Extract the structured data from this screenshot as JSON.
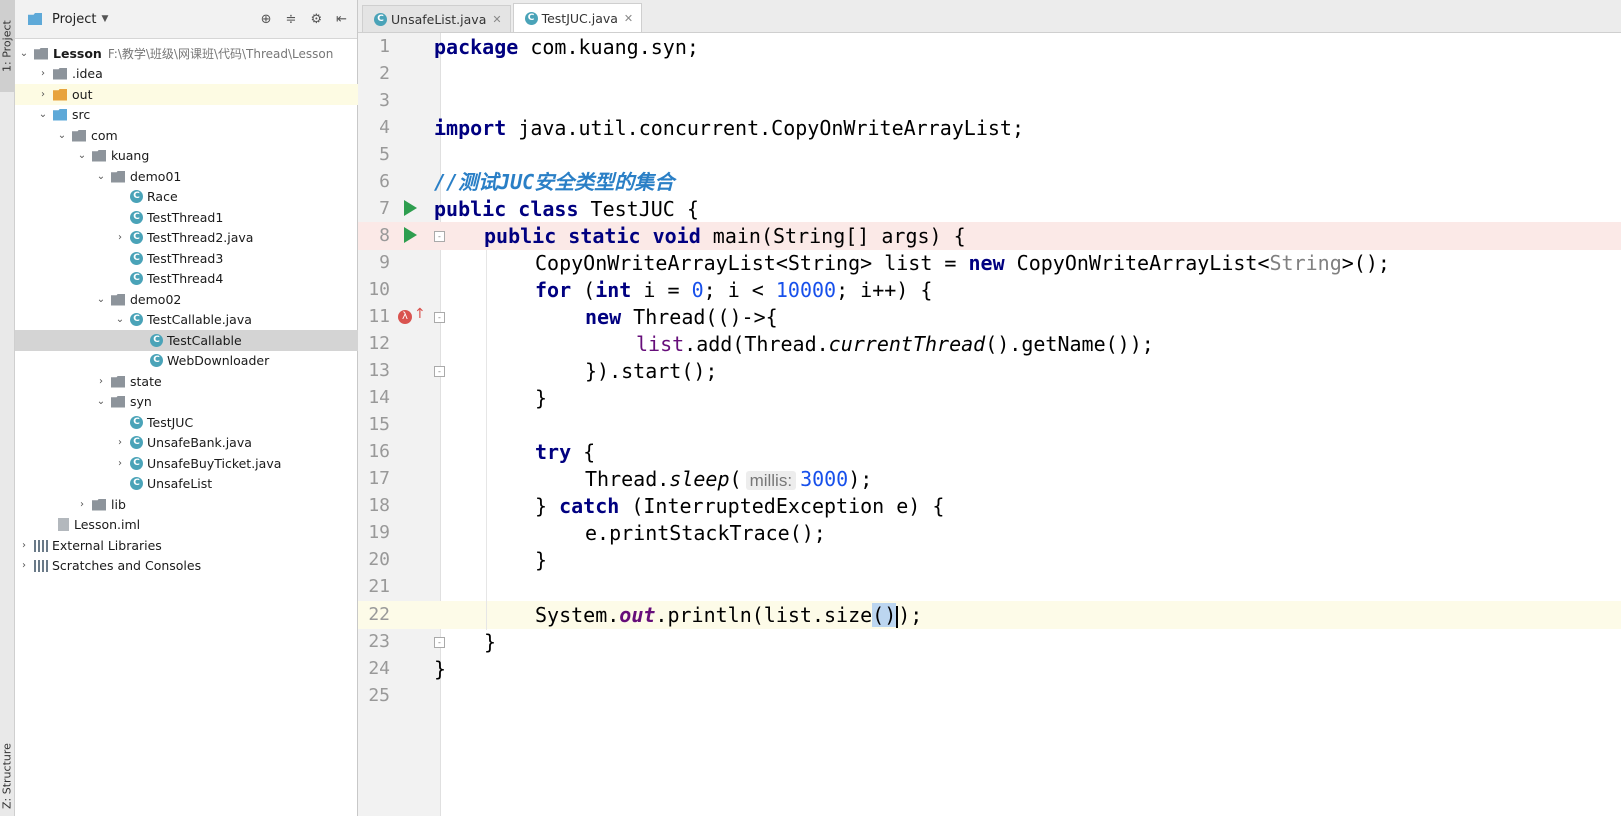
{
  "sidebar_tabs": {
    "project": "1: Project",
    "structure": "Z: Structure"
  },
  "project_panel": {
    "title": "Project",
    "tree": [
      {
        "label": "Lesson",
        "path": "F:\\教学\\班级\\网课班\\代码\\Thread\\Lesson"
      },
      {
        "label": ".idea"
      },
      {
        "label": "out"
      },
      {
        "label": "src"
      },
      {
        "label": "com"
      },
      {
        "label": "kuang"
      },
      {
        "label": "demo01"
      },
      {
        "label": "Race"
      },
      {
        "label": "TestThread1"
      },
      {
        "label": "TestThread2.java"
      },
      {
        "label": "TestThread3"
      },
      {
        "label": "TestThread4"
      },
      {
        "label": "demo02"
      },
      {
        "label": "TestCallable.java"
      },
      {
        "label": "TestCallable"
      },
      {
        "label": "WebDownloader"
      },
      {
        "label": "state"
      },
      {
        "label": "syn"
      },
      {
        "label": "TestJUC"
      },
      {
        "label": "UnsafeBank.java"
      },
      {
        "label": "UnsafeBuyTicket.java"
      },
      {
        "label": "UnsafeList"
      },
      {
        "label": "lib"
      },
      {
        "label": "Lesson.iml"
      },
      {
        "label": "External Libraries"
      },
      {
        "label": "Scratches and Consoles"
      }
    ]
  },
  "editor": {
    "tabs": [
      {
        "label": "UnsafeList.java"
      },
      {
        "label": "TestJUC.java"
      }
    ],
    "line_numbers": [
      "1",
      "2",
      "3",
      "4",
      "5",
      "6",
      "7",
      "8",
      "9",
      "10",
      "11",
      "12",
      "13",
      "14",
      "15",
      "16",
      "17",
      "18",
      "19",
      "20",
      "21",
      "22",
      "23",
      "24",
      "25"
    ],
    "code": {
      "l1_kw": "package",
      "l1_rest": " com.kuang.syn;",
      "l4_kw": "import",
      "l4_rest": " java.util.concurrent.CopyOnWriteArrayList;",
      "l6_comment": "//测试JUC安全类型的集合",
      "l7_kw": "public class",
      "l7_rest": " TestJUC {",
      "l8_kw": "public static void",
      "l8_rest": " main(String[] args) {",
      "l9_a": "CopyOnWriteArrayList<String> list = ",
      "l9_kw": "new",
      "l9_b": " CopyOnWriteArrayList<",
      "l9_gen": "String",
      "l9_c": ">();",
      "l10_kw": "for",
      "l10_a": " (",
      "l10_kw2": "int",
      "l10_b": " i = ",
      "l10_n1": "0",
      "l10_c": "; i < ",
      "l10_n2": "10000",
      "l10_d": "; i++) {",
      "l11_kw": "new",
      "l11_rest": " Thread(()->{",
      "l12_a": "list",
      "l12_b": ".add(Thread.",
      "l12_it": "currentThread",
      "l12_c": "().getName());",
      "l13": "}).start();",
      "l14": "}",
      "l16_kw": "try",
      "l16_rest": " {",
      "l17_a": "Thread.",
      "l17_it": "sleep",
      "l17_b": "(",
      "l17_hint": "millis:",
      "l17_num": "3000",
      "l17_c": ");",
      "l18_a": "} ",
      "l18_kw": "catch",
      "l18_b": " (InterruptedException e) {",
      "l19": "e.printStackTrace();",
      "l20": "}",
      "l22_a": "System.",
      "l22_out": "out",
      "l22_b": ".println(list.size",
      "l22_sel": "()",
      "l22_c": ");",
      "l23": "}",
      "l24": "}"
    }
  }
}
